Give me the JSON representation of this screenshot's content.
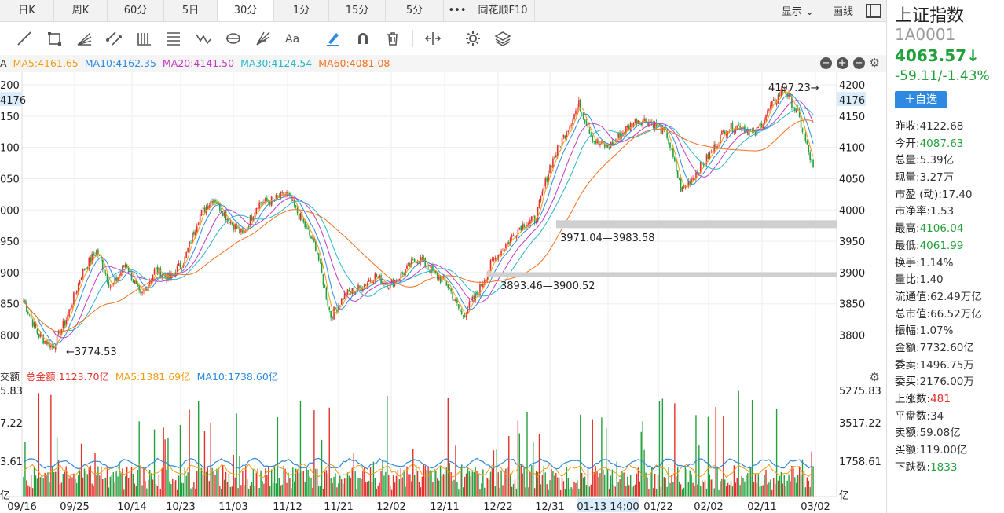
{
  "tabs": [
    {
      "label": "日K",
      "active": false
    },
    {
      "label": "周K",
      "active": false
    },
    {
      "label": "60分",
      "active": false
    },
    {
      "label": "5日",
      "active": false
    },
    {
      "label": "30分",
      "active": true
    },
    {
      "label": "1分",
      "active": false
    },
    {
      "label": "15分",
      "active": false
    },
    {
      "label": "5分",
      "active": false
    },
    {
      "label": "•••",
      "active": false
    },
    {
      "label": "同花顺F10",
      "active": false
    }
  ],
  "top_right": {
    "display": "显示",
    "draw": "画线"
  },
  "toolbar_icons": [
    "line-tool-icon",
    "rectangle-tool-icon",
    "fan-tool-icon",
    "channel-tool-icon",
    "bars-tool-icon",
    "fibonacci-tool-icon",
    "wave-tool-icon",
    "cycle-tool-icon",
    "gann-tool-icon",
    "text-tool-icon",
    "pen-icon",
    "magnet-icon",
    "trash-icon",
    "measure-icon",
    "settings-icon",
    "layers-icon"
  ],
  "ma_legend": [
    {
      "label": "A",
      "color": "#333333"
    },
    {
      "label": "MA5:4161.65",
      "color": "#f39c12"
    },
    {
      "label": "MA10:4162.35",
      "color": "#2d8ae0"
    },
    {
      "label": "MA20:4141.50",
      "color": "#c03bc0"
    },
    {
      "label": "MA30:4124.54",
      "color": "#27b7c8"
    },
    {
      "label": "MA60:4081.08",
      "color": "#f07020"
    }
  ],
  "volume_legend": [
    {
      "label": "交额",
      "color": "#333333"
    },
    {
      "label": "总金额:1123.70亿",
      "color": "#e5312b"
    },
    {
      "label": "MA5:1381.69亿",
      "color": "#f39c12"
    },
    {
      "label": "MA10:1738.60亿",
      "color": "#2d8ae0"
    }
  ],
  "chart_data": {
    "type": "candlestick",
    "price_axis_ticks": [
      "4200",
      "4176",
      "4150",
      "4100",
      "4050",
      "4000",
      "3950",
      "3900",
      "3850",
      "3800"
    ],
    "price_axis_left_ticks": [
      "200",
      "4176",
      "150",
      "100",
      "050",
      "000",
      "950",
      "900",
      "850",
      "800"
    ],
    "ylim": [
      3770,
      4210
    ],
    "current_price_label": "4176",
    "annotations": [
      {
        "text": "4197.23→",
        "price": 4197.23,
        "x": "03/02"
      },
      {
        "text": "←3774.53",
        "price": 3774.53,
        "x": "09/25"
      },
      {
        "text": "3971.04—3983.58",
        "price_low": 3971.04,
        "price_high": 3983.58
      },
      {
        "text": "3893.46—3900.52",
        "price_low": 3893.46,
        "price_high": 3900.52
      }
    ],
    "x_labels": [
      "09/16",
      "09/25",
      "10/14",
      "10/23",
      "11/03",
      "11/12",
      "11/21",
      "12/02",
      "12/11",
      "12/22",
      "12/31",
      "01-13 14:00",
      "01/22",
      "02/02",
      "02/11",
      "03/02"
    ],
    "highlight_x_label": "01-13 14:00",
    "trend": [
      3855,
      3800,
      3780,
      3830,
      3900,
      3935,
      3875,
      3915,
      3860,
      3905,
      3890,
      3920,
      3990,
      4020,
      3985,
      3960,
      4010,
      4015,
      4025,
      3985,
      3940,
      3830,
      3865,
      3875,
      3895,
      3880,
      3900,
      3925,
      3900,
      3880,
      3830,
      3865,
      3915,
      3945,
      3975,
      3985,
      4070,
      4120,
      4170,
      4110,
      4100,
      4125,
      4145,
      4140,
      4120,
      4030,
      4060,
      4090,
      4130,
      4135,
      4120,
      4160,
      4195,
      4150,
      4065
    ],
    "volume_axis_ticks": [
      "5275.83",
      "3517.22",
      "1758.61",
      "亿"
    ],
    "volume_axis_left_ticks": [
      "5.83",
      "7.22",
      "3.61",
      "亿"
    ]
  },
  "quote": {
    "name": "上证指数",
    "code": "1A0001",
    "price": "4063.57↓",
    "change": "-59.11/-1.43%",
    "fav_button": "＋自选",
    "stats": [
      {
        "k": "昨收:",
        "v": "4122.68",
        "c": ""
      },
      {
        "k": "今开:",
        "v": "4087.63",
        "c": "g"
      },
      {
        "k": "总量:",
        "v": "5.39亿",
        "c": ""
      },
      {
        "k": "现量:",
        "v": "3.27万",
        "c": ""
      },
      {
        "k": "市盈 (动):",
        "v": "17.40",
        "c": ""
      },
      {
        "k": "市净率:",
        "v": "1.53",
        "c": ""
      },
      {
        "k": "最高:",
        "v": "4106.04",
        "c": "g"
      },
      {
        "k": "最低:",
        "v": "4061.99",
        "c": "g"
      },
      {
        "k": "换手:",
        "v": "1.14%",
        "c": ""
      },
      {
        "k": "量比:",
        "v": "1.40",
        "c": ""
      },
      {
        "k": "流通值:",
        "v": "62.49万亿",
        "c": ""
      },
      {
        "k": "总市值:",
        "v": "66.52万亿",
        "c": ""
      },
      {
        "k": "振幅:",
        "v": "1.07%",
        "c": ""
      },
      {
        "k": "金额:",
        "v": "7732.60亿",
        "c": ""
      },
      {
        "k": "委卖:",
        "v": "1496.75万",
        "c": ""
      },
      {
        "k": "委买:",
        "v": "2176.00万",
        "c": ""
      },
      {
        "k": "上涨数:",
        "v": "481",
        "c": "r"
      },
      {
        "k": "平盘数:",
        "v": "34",
        "c": ""
      },
      {
        "k": "卖额:",
        "v": "59.08亿",
        "c": ""
      },
      {
        "k": "买额:",
        "v": "119.00亿",
        "c": ""
      },
      {
        "k": "下跌数:",
        "v": "1833",
        "c": "g"
      }
    ]
  }
}
